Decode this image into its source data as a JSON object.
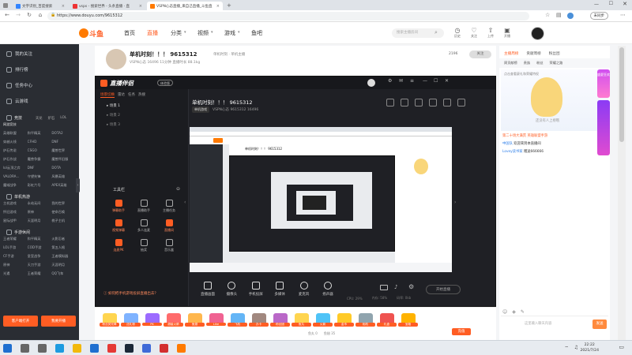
{
  "browser": {
    "tabs": [
      {
        "label": "文字识别_百度搜索",
        "color": "#3385ff"
      },
      {
        "label": "vsps - 搜索世界 - 头条直播 · 直",
        "color": "#e33"
      },
      {
        "label": "VSPN心态直播_来自己直播_斗鱼直",
        "color": "#ff7a00"
      }
    ],
    "new_tab": "+",
    "url": "https://www.douyu.com/9615312",
    "not_sync": "未同步"
  },
  "header": {
    "logo": "斗鱼",
    "nav": [
      "首页",
      "直播",
      "分类",
      "视频",
      "游戏",
      "鱼吧"
    ],
    "active_nav": "直播",
    "search_placeholder": "搜索主播房间",
    "icons": [
      {
        "icon": "history-icon",
        "label": "历史"
      },
      {
        "icon": "follow-icon",
        "label": "关注"
      },
      {
        "icon": "upload-icon",
        "label": "上传"
      },
      {
        "icon": "broadcast-icon",
        "label": "开播"
      }
    ]
  },
  "sidebar": {
    "items": [
      {
        "label": "我的关注",
        "icon": "heart-icon"
      },
      {
        "label": "排行榜",
        "icon": "rank-icon"
      },
      {
        "label": "任务中心",
        "icon": "task-icon"
      },
      {
        "label": "云游戏",
        "icon": "cloud-game-icon"
      }
    ],
    "sections": [
      {
        "title": "竞技",
        "icons": [
          "天龙",
          "炉石",
          "LOL"
        ],
        "rows": [
          [
            "网游竞技",
            "",
            ""
          ],
          [
            "英雄联盟",
            "和平精英",
            "DOTA2"
          ],
          [
            "穿越火线",
            "CFHD",
            "DNF"
          ],
          [
            "炉石传说",
            "CSGO",
            "魔兽世界"
          ],
          [
            "炉石作战",
            "魔兽争霸",
            "魔兽怀旧服"
          ],
          [
            "lol云顶之弈",
            "DNF",
            "DOTA"
          ],
          [
            "VALORA...",
            "守望先锋",
            "风暴英雄"
          ],
          [
            "魔域战争",
            "彩虹六号",
            "APEX英雄"
          ]
        ]
      },
      {
        "title": "单机热游",
        "rows": [
          [
            "主机游戏",
            "永劫无间",
            "我的世界"
          ],
          [
            "怀旧游戏",
            "原神",
            "使命召唤"
          ],
          [
            "星际战甲",
            "天涯明月",
            "桃子主机"
          ]
        ]
      },
      {
        "title": "手游休闲",
        "rows": [
          [
            "王者荣耀",
            "和平精英",
            "火影忍者"
          ],
          [
            "LOL手游",
            "COD手游",
            "第五人格"
          ],
          [
            "CF手游",
            "皇室战争",
            "王者模拟器"
          ],
          [
            "原神",
            "天刀手游",
            "天涯明月"
          ],
          [
            "光遇",
            "王者荣耀",
            "QQ飞车"
          ]
        ]
      }
    ],
    "buttons": [
      "客户端打开",
      "我要开播"
    ]
  },
  "room": {
    "title": "单机时刻！！！ 9615312",
    "sub": "单机时刻 · 单机主播",
    "meta": "VSPN心态  16496  11分钟  直播时长  88.1kg",
    "follow_count": "2196",
    "follow": "关注"
  },
  "app": {
    "title": "直播伴侣",
    "badge": "体验版",
    "tabs": [
      "场景切换",
      "雷达",
      "任务",
      "热搜"
    ],
    "scenes": [
      "场景 1",
      "场景 2",
      "场景 3"
    ],
    "stream_title": "单机时刻！！！ 9615312",
    "stream_category": "单机游戏",
    "stream_meta": "VSPN心态  9615312  16496",
    "tools_title": "工具栏",
    "tools": [
      "弹幕助手",
      "直播助手",
      "主播任务",
      "视频弹幕",
      "多人连麦",
      "直播间",
      "连麦PK",
      "抽奖",
      "音乐盒"
    ],
    "toolbar": [
      "直播画面",
      "摄像头",
      "手机投屏",
      "多媒体",
      "麦克风",
      "扬声器"
    ],
    "start_live": "开始直播",
    "footer": [
      "CPU: 29%",
      "内存: 58%",
      "码率: 0kb"
    ],
    "tip": "如何把手机游戏投屏直播出去？"
  },
  "gifts": [
    {
      "label": "粉丝荧光棒",
      "color": "#ffd54f"
    },
    {
      "label": "送礼物",
      "color": "#7fb3ff"
    },
    {
      "label": "PK",
      "color": "#9c6bff"
    },
    {
      "label": "超级火箭",
      "color": "#ff6b6b"
    },
    {
      "label": "鱼翅",
      "color": "#ffb74d"
    },
    {
      "label": "Like",
      "color": "#f06292"
    },
    {
      "label": "飞机",
      "color": "#64b5f6"
    },
    {
      "label": "办卡",
      "color": "#a1887f"
    },
    {
      "label": "粉丝团",
      "color": "#ba68c8"
    },
    {
      "label": "鱼丸",
      "color": "#ffd54f"
    },
    {
      "label": "火箭",
      "color": "#4fc3f7"
    },
    {
      "label": "金币",
      "color": "#ffca28"
    },
    {
      "label": "相机",
      "color": "#90a4ae"
    },
    {
      "label": "礼盒",
      "color": "#ef5350"
    },
    {
      "label": "宝箱",
      "color": "#ffb300"
    }
  ],
  "gift_footer": {
    "fish_balls": "鱼丸 0",
    "fish_fins": "鱼翅 35",
    "charge": "充值"
  },
  "chat": {
    "tabs": [
      "主播周榜",
      "贡献周榜",
      "粉丝团"
    ],
    "subtabs": [
      "周贡献榜",
      "贵族",
      "粉丝",
      "荣耀之路"
    ],
    "tip": "点击查看豪礼和荣耀特权",
    "rank_empty": "还没有人上榜哦",
    "messages": [
      {
        "user": "",
        "text": "第二十场大满贯 英雄联盟手游"
      },
      {
        "user": "中国队",
        "text": "欢迎来到本直播间"
      },
      {
        "user": "Lovey读书家",
        "text": "赠送666666"
      }
    ],
    "input_placeholder": "这里输入聊天内容",
    "send": "发送",
    "promo": "盛夏狂欢"
  },
  "taskbar": {
    "apps": [
      {
        "name": "start-icon",
        "color": "#1f6fd0"
      },
      {
        "name": "search-icon",
        "color": "#666"
      },
      {
        "name": "taskview-icon",
        "color": "#666"
      },
      {
        "name": "edge-icon",
        "color": "#1d9be0"
      },
      {
        "name": "explorer-icon",
        "color": "#f2b90d"
      },
      {
        "name": "store-icon",
        "color": "#1f6fd0"
      },
      {
        "name": "app-red-icon",
        "color": "#e53935"
      },
      {
        "name": "steam-icon",
        "color": "#1b2838"
      },
      {
        "name": "app-blue-icon",
        "color": "#3f6ad8"
      },
      {
        "name": "opera-icon",
        "color": "#d32f2f"
      },
      {
        "name": "douyu-icon",
        "color": "#ff7a00"
      }
    ],
    "time": "22:22",
    "date": "2021/7/24"
  }
}
